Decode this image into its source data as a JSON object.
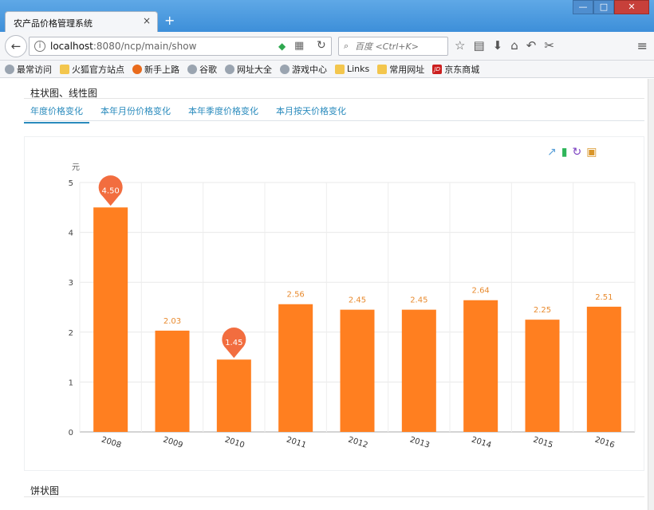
{
  "browser": {
    "tab_title": "农产品价格管理系统",
    "tab_close": "×",
    "new_tab": "+",
    "minimize": "—",
    "maximize": "□",
    "close": "✕",
    "back": "←",
    "url_host": "localhost",
    "url_path": ":8080/ncp/main/show",
    "search_placeholder": "百度 <Ctrl+K>",
    "bookmarks": [
      "最常访问",
      "火狐官方站点",
      "新手上路",
      "谷歌",
      "网址大全",
      "游戏中心",
      "Links",
      "常用网址",
      "京东商城"
    ]
  },
  "page": {
    "panel_title": "柱状图、线性图",
    "tabs": [
      "年度价格变化",
      "本年月份价格变化",
      "本年季度价格变化",
      "本月按天价格变化"
    ],
    "pie_title": "饼状图"
  },
  "colors": {
    "bar": "#ff7f20",
    "label": "#e88a2e",
    "marker": "#f26d3f",
    "tab_active": "#2a8bbd"
  },
  "chart_data": {
    "type": "bar",
    "ylabel": "元",
    "ylim": [
      0,
      5
    ],
    "yticks": [
      0,
      1,
      2,
      3,
      4,
      5
    ],
    "categories": [
      "2008",
      "2009",
      "2010",
      "2011",
      "2012",
      "2013",
      "2014",
      "2015",
      "2016"
    ],
    "values": [
      4.5,
      2.03,
      1.45,
      2.56,
      2.45,
      2.45,
      2.64,
      2.25,
      2.51
    ],
    "value_labels": [
      "4.50",
      "2.03",
      "1.45",
      "2.56",
      "2.45",
      "2.45",
      "2.64",
      "2.25",
      "2.51"
    ],
    "markers": [
      "max",
      null,
      "min",
      null,
      null,
      null,
      null,
      null,
      null
    ],
    "grid": true
  }
}
